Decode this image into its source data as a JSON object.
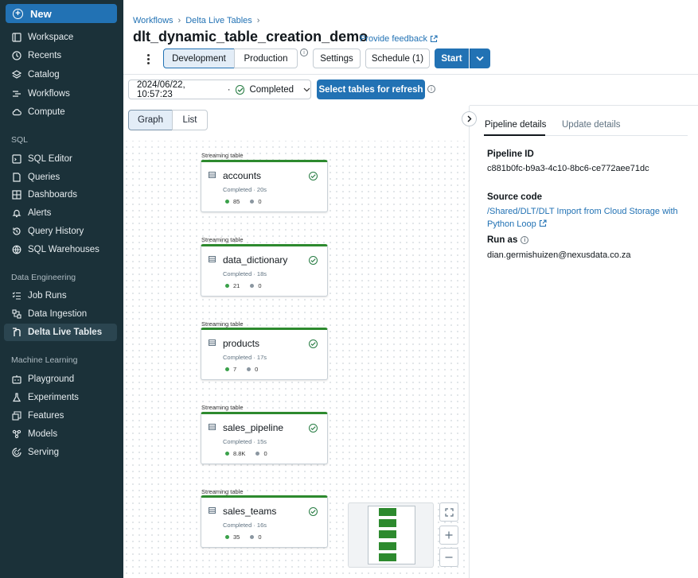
{
  "sidebar": {
    "new_label": "New",
    "items_top": [
      {
        "label": "Workspace",
        "icon": "workspace-icon"
      },
      {
        "label": "Recents",
        "icon": "clock-icon"
      },
      {
        "label": "Catalog",
        "icon": "catalog-icon"
      },
      {
        "label": "Workflows",
        "icon": "workflows-icon"
      },
      {
        "label": "Compute",
        "icon": "cloud-icon"
      }
    ],
    "sql_section": "SQL",
    "items_sql": [
      {
        "label": "SQL Editor",
        "icon": "sql-editor-icon"
      },
      {
        "label": "Queries",
        "icon": "queries-icon"
      },
      {
        "label": "Dashboards",
        "icon": "dashboards-icon"
      },
      {
        "label": "Alerts",
        "icon": "bell-icon"
      },
      {
        "label": "Query History",
        "icon": "history-icon"
      },
      {
        "label": "SQL Warehouses",
        "icon": "warehouse-icon"
      }
    ],
    "de_section": "Data Engineering",
    "items_de": [
      {
        "label": "Job Runs",
        "icon": "job-runs-icon"
      },
      {
        "label": "Data Ingestion",
        "icon": "ingestion-icon"
      },
      {
        "label": "Delta Live Tables",
        "icon": "dlt-icon",
        "active": true
      }
    ],
    "ml_section": "Machine Learning",
    "items_ml": [
      {
        "label": "Playground",
        "icon": "playground-icon"
      },
      {
        "label": "Experiments",
        "icon": "flask-icon"
      },
      {
        "label": "Features",
        "icon": "features-icon"
      },
      {
        "label": "Models",
        "icon": "models-icon"
      },
      {
        "label": "Serving",
        "icon": "serving-icon"
      }
    ]
  },
  "header": {
    "breadcrumb": [
      "Workflows",
      "Delta Live Tables"
    ],
    "title": "dlt_dynamic_table_creation_demo",
    "feedback": "Provide feedback",
    "mode_dev": "Development",
    "mode_prod": "Production",
    "settings": "Settings",
    "schedule": "Schedule (1)",
    "start": "Start"
  },
  "run": {
    "timestamp": "2024/06/22, 10:57:23",
    "separator": "·",
    "status": "Completed",
    "refresh_button": "Select tables for refresh"
  },
  "view": {
    "graph": "Graph",
    "list": "List"
  },
  "nodes": [
    {
      "type": "Streaming table",
      "name": "accounts",
      "status": "Completed · 20s",
      "upserted": "85",
      "dropped": "0"
    },
    {
      "type": "Streaming table",
      "name": "data_dictionary",
      "status": "Completed · 18s",
      "upserted": "21",
      "dropped": "0"
    },
    {
      "type": "Streaming table",
      "name": "products",
      "status": "Completed · 17s",
      "upserted": "7",
      "dropped": "0"
    },
    {
      "type": "Streaming table",
      "name": "sales_pipeline",
      "status": "Completed · 15s",
      "upserted": "8.8K",
      "dropped": "0"
    },
    {
      "type": "Streaming table",
      "name": "sales_teams",
      "status": "Completed · 16s",
      "upserted": "35",
      "dropped": "0"
    }
  ],
  "details": {
    "tab_pipeline": "Pipeline details",
    "tab_update": "Update details",
    "pipeline_id_label": "Pipeline ID",
    "pipeline_id": "c881b0fc-b9a3-4c10-8bc6-ce772aee71dc",
    "source_code_label": "Source code",
    "source_code": "/Shared/DLT/DLT Import from Cloud Storage with Python Loop",
    "run_as_label": "Run as",
    "run_as": "dian.germishuizen@nexusdata.co.za"
  },
  "colors": {
    "sidebar_bg": "#1b3139",
    "primary": "#2272b4",
    "success": "#2d8a2e"
  }
}
